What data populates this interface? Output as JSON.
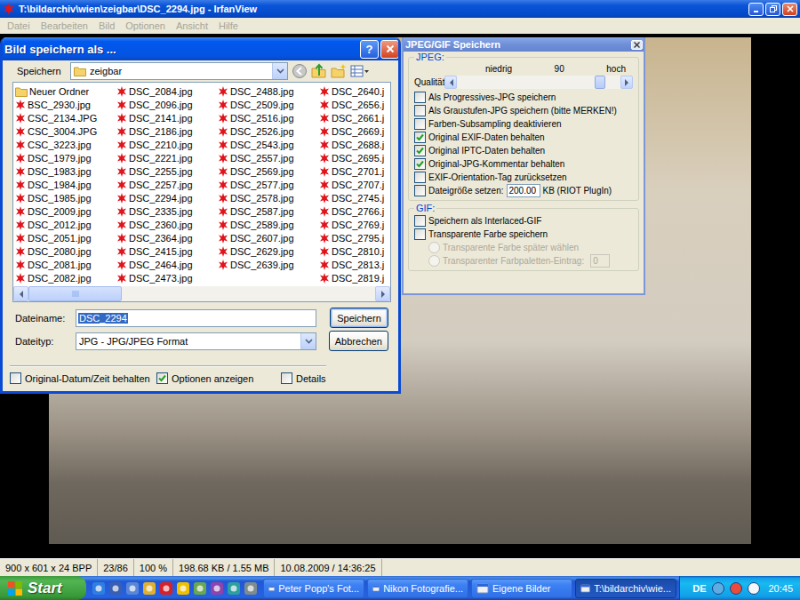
{
  "window": {
    "title": "T:\\bildarchiv\\wien\\zeigbar\\DSC_2294.jpg - IrfanView"
  },
  "menu": [
    {
      "label": "Datei",
      "disabled": true
    },
    {
      "label": "Bearbeiten",
      "disabled": true
    },
    {
      "label": "Bild",
      "disabled": true
    },
    {
      "label": "Optionen",
      "disabled": true
    },
    {
      "label": "Ansicht",
      "disabled": true
    },
    {
      "label": "Hilfe",
      "disabled": true
    }
  ],
  "save_dialog": {
    "title": "Bild speichern als ...",
    "help": "?",
    "location_label": "Speichern",
    "location": "zeigbar",
    "file_columns": [
      [
        {
          "name": "Neuer Ordner",
          "kind": "folder"
        },
        {
          "name": "BSC_2930.jpg",
          "kind": "image"
        },
        {
          "name": "CSC_2134.JPG",
          "kind": "image"
        },
        {
          "name": "CSC_3004.JPG",
          "kind": "image"
        },
        {
          "name": "CSC_3223.jpg",
          "kind": "image"
        },
        {
          "name": "DSC_1979.jpg",
          "kind": "image"
        },
        {
          "name": "DSC_1983.jpg",
          "kind": "image"
        },
        {
          "name": "DSC_1984.jpg",
          "kind": "image"
        },
        {
          "name": "DSC_1985.jpg",
          "kind": "image"
        },
        {
          "name": "DSC_2009.jpg",
          "kind": "image"
        },
        {
          "name": "DSC_2012.jpg",
          "kind": "image"
        },
        {
          "name": "DSC_2051.jpg",
          "kind": "image"
        },
        {
          "name": "DSC_2080.jpg",
          "kind": "image"
        },
        {
          "name": "DSC_2081.jpg",
          "kind": "image"
        },
        {
          "name": "DSC_2082.jpg",
          "kind": "image"
        }
      ],
      [
        {
          "name": "DSC_2084.jpg",
          "kind": "image"
        },
        {
          "name": "DSC_2096.jpg",
          "kind": "image"
        },
        {
          "name": "DSC_2141.jpg",
          "kind": "image"
        },
        {
          "name": "DSC_2186.jpg",
          "kind": "image"
        },
        {
          "name": "DSC_2210.jpg",
          "kind": "image"
        },
        {
          "name": "DSC_2221.jpg",
          "kind": "image"
        },
        {
          "name": "DSC_2255.jpg",
          "kind": "image"
        },
        {
          "name": "DSC_2257.jpg",
          "kind": "image"
        },
        {
          "name": "DSC_2294.jpg",
          "kind": "image"
        },
        {
          "name": "DSC_2335.jpg",
          "kind": "image"
        },
        {
          "name": "DSC_2360.jpg",
          "kind": "image"
        },
        {
          "name": "DSC_2364.jpg",
          "kind": "image"
        },
        {
          "name": "DSC_2415.jpg",
          "kind": "image"
        },
        {
          "name": "DSC_2464.jpg",
          "kind": "image"
        },
        {
          "name": "DSC_2473.jpg",
          "kind": "image"
        }
      ],
      [
        {
          "name": "DSC_2488.jpg",
          "kind": "image"
        },
        {
          "name": "DSC_2509.jpg",
          "kind": "image"
        },
        {
          "name": "DSC_2516.jpg",
          "kind": "image"
        },
        {
          "name": "DSC_2526.jpg",
          "kind": "image"
        },
        {
          "name": "DSC_2543.jpg",
          "kind": "image"
        },
        {
          "name": "DSC_2557.jpg",
          "kind": "image"
        },
        {
          "name": "DSC_2569.jpg",
          "kind": "image"
        },
        {
          "name": "DSC_2577.jpg",
          "kind": "image"
        },
        {
          "name": "DSC_2578.jpg",
          "kind": "image"
        },
        {
          "name": "DSC_2587.jpg",
          "kind": "image"
        },
        {
          "name": "DSC_2589.jpg",
          "kind": "image"
        },
        {
          "name": "DSC_2607.jpg",
          "kind": "image"
        },
        {
          "name": "DSC_2629.jpg",
          "kind": "image"
        },
        {
          "name": "DSC_2639.jpg",
          "kind": "image"
        }
      ],
      [
        {
          "name": "DSC_2640.j",
          "kind": "image"
        },
        {
          "name": "DSC_2656.j",
          "kind": "image"
        },
        {
          "name": "DSC_2661.j",
          "kind": "image"
        },
        {
          "name": "DSC_2669.j",
          "kind": "image"
        },
        {
          "name": "DSC_2688.j",
          "kind": "image"
        },
        {
          "name": "DSC_2695.j",
          "kind": "image"
        },
        {
          "name": "DSC_2701.j",
          "kind": "image"
        },
        {
          "name": "DSC_2707.j",
          "kind": "image"
        },
        {
          "name": "DSC_2745.j",
          "kind": "image"
        },
        {
          "name": "DSC_2766.j",
          "kind": "image"
        },
        {
          "name": "DSC_2769.j",
          "kind": "image"
        },
        {
          "name": "DSC_2795.j",
          "kind": "image"
        },
        {
          "name": "DSC_2810.j",
          "kind": "image"
        },
        {
          "name": "DSC_2813.j",
          "kind": "image"
        },
        {
          "name": "DSC_2819.j",
          "kind": "image"
        }
      ]
    ],
    "filename_label": "Dateiname:",
    "filename": "DSC_2294",
    "filename_selected": true,
    "filetype_label": "Dateityp:",
    "filetype": "JPG - JPG/JPEG Format",
    "save_button": "Speichern",
    "cancel_button": "Abbrechen",
    "options": [
      {
        "label": "Original-Datum/Zeit behalten",
        "checked": false
      },
      {
        "label": "Optionen anzeigen",
        "checked": true
      },
      {
        "label": "Details",
        "checked": false
      }
    ]
  },
  "jpeg_dialog": {
    "title": "JPEG/GIF Speichern",
    "jpeg_group": "JPEG:",
    "quality_low": "niedrig",
    "quality_value": "90",
    "quality_high": "hoch",
    "quality_label": "Qualität:",
    "quality_level": 0.9,
    "jpeg_options": [
      {
        "kind": "checkbox",
        "label": "Als Progressives-JPG speichern",
        "checked": false
      },
      {
        "kind": "checkbox",
        "label": "Als Graustufen-JPG speichern (bitte MERKEN!)",
        "checked": false
      },
      {
        "kind": "checkbox",
        "label": "Farben-Subsampling deaktivieren",
        "checked": false
      },
      {
        "kind": "checkbox",
        "label": "Original EXIF-Daten behalten",
        "checked": true
      },
      {
        "kind": "checkbox",
        "label": "Original IPTC-Daten behalten",
        "checked": true
      },
      {
        "kind": "checkbox",
        "label": "Original-JPG-Kommentar behalten",
        "checked": true
      },
      {
        "kind": "checkbox",
        "label": "EXIF-Orientation-Tag zurücksetzen",
        "checked": false
      },
      {
        "kind": "checkbox-field",
        "label": "Dateigröße setzen:",
        "checked": false,
        "value": "200.00",
        "unit": "KB (RIOT PlugIn)"
      }
    ],
    "gif_group": "GIF:",
    "gif_options": [
      {
        "kind": "checkbox",
        "label": "Speichern als Interlaced-GIF",
        "checked": false,
        "disabled": false
      },
      {
        "kind": "checkbox",
        "label": "Transparente Farbe speichern",
        "checked": false,
        "disabled": false
      },
      {
        "kind": "radio",
        "label": "Transparente Farbe später wählen",
        "selected": false,
        "disabled": true
      },
      {
        "kind": "radio-field",
        "label": "Transparenter Farbpaletten-Eintrag:",
        "selected": false,
        "disabled": true,
        "value": "0"
      }
    ]
  },
  "status_bar": [
    "900 x 601 x 24 BPP",
    "23/86",
    "100 %",
    "198.68 KB / 1.55 MB",
    "10.08.2009 / 14:36:25"
  ],
  "taskbar": {
    "start": "Start",
    "tasks": [
      {
        "label": "Peter Popp's Fot...",
        "selected": false
      },
      {
        "label": "Nikon Fotografie...",
        "selected": false
      },
      {
        "label": "Eigene Bilder",
        "selected": false
      },
      {
        "label": "T:\\bildarchiv\\wie...",
        "selected": true
      }
    ],
    "language": "DE",
    "clock": "20:45"
  }
}
